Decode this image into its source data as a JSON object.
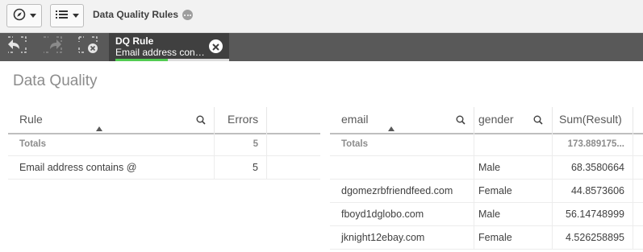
{
  "toolbar": {
    "app_title": "Data Quality Rules",
    "icons": [
      "compass-icon",
      "list-icon",
      "more-icon"
    ]
  },
  "selections": {
    "tools": [
      "smart-search-step-back-icon",
      "step-forward-icon",
      "clear-all-selections-icon"
    ],
    "chip": {
      "field": "DQ Rule",
      "value": "Email address contains @"
    }
  },
  "sheet": {
    "title": "Data Quality"
  },
  "rule_table": {
    "columns": [
      "Rule",
      "Errors"
    ],
    "totals_label": "Totals",
    "totals": {
      "errors": "5"
    },
    "rows": [
      {
        "rule": "Email address contains @",
        "errors": "5"
      }
    ]
  },
  "detail_table": {
    "columns": [
      "email",
      "gender",
      "Sum(Result)"
    ],
    "totals_label": "Totals",
    "totals": {
      "sum": "173.889175..."
    },
    "rows": [
      {
        "email": "",
        "gender": "Male",
        "sum": "68.3580664"
      },
      {
        "email": "dgomezrbfriendfeed.com",
        "gender": "Female",
        "sum": "44.8573606"
      },
      {
        "email": "fboyd1dglobo.com",
        "gender": "Male",
        "sum": "56.14748999"
      },
      {
        "email": "jknight12ebay.com",
        "gender": "Female",
        "sum": "4.526258895"
      }
    ]
  },
  "colors": {
    "toolbar_bg": "#f2f2f2",
    "selection_bar_bg": "#595959",
    "selection_chip_bg": "#404040",
    "selected_green": "#52cc52"
  }
}
